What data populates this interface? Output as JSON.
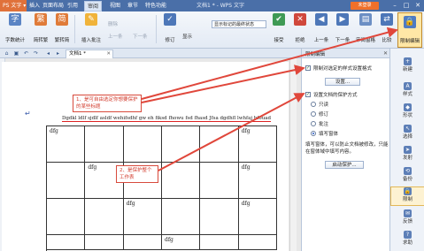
{
  "titlebar": {
    "app_button": "PS 文字 ▾",
    "menus": [
      "插入",
      "页面布局",
      "引用",
      "审阅",
      "视图",
      "章节",
      "特色功能"
    ],
    "active_menu": "审阅",
    "window_title": "文档1 * - WPS 文字",
    "login": "未登录"
  },
  "ribbon": {
    "buttons": {
      "spell": "字数统计",
      "simp_trad": "简转繁",
      "trad_simp": "繁转简",
      "insert_comment": "插入批注",
      "prev_comment": "上一条",
      "next_comment": "下一条",
      "delete_comment": "删除",
      "revise": "修订",
      "show": "显示",
      "accept": "接受",
      "reject": "拒绝",
      "prev": "上一条",
      "next": "下一条",
      "review_pane": "审阅窗格",
      "compare": "比较",
      "restrict": "限制编辑"
    },
    "markup_select": "显示标记的最终状态"
  },
  "tabs": {
    "doc_tab": "文档1 *"
  },
  "document": {
    "text_line": "Dgdkl ldlf sjdlf asldf wehifsdhf gw eh fiksd fhowu fsd fhasd Jfsa dgdhfl lwhfaj hfouad",
    "cells": [
      [
        "dfg",
        "",
        "",
        "",
        "",
        "dfg"
      ],
      [
        "",
        "dfg",
        "",
        "",
        "",
        "dfg"
      ],
      [
        "",
        "",
        "dfg",
        "",
        "",
        "dfg"
      ],
      [
        "",
        "",
        "",
        "dfg",
        "",
        ""
      ]
    ]
  },
  "callouts": {
    "first": "1、是可自由选定你想要保护的某些标题",
    "second": "2、是保护整个工作表"
  },
  "pane": {
    "title": "限制编辑",
    "opt1_label": "限制对选定的样式设置格式",
    "settings_button": "设置...",
    "opt2_label": "设置文档的保护方式",
    "radio": [
      "只读",
      "修订",
      "批注",
      "填写窗体"
    ],
    "radio_selected": 3,
    "desc_line1": "填写窗体，可以防止文档被修改，只能",
    "desc_line2": "在窗体域中填写内容。",
    "start_button": "启动保护..."
  },
  "sidebar": {
    "items": [
      "新建",
      "样式",
      "形状",
      "选择",
      "发射",
      "备份",
      "限制",
      "反馈",
      "求助"
    ],
    "active_index": 6
  },
  "colors": {
    "annotation": "#d84a3c",
    "title_bar": "#4a6fa8",
    "accent": "#f0702a"
  }
}
